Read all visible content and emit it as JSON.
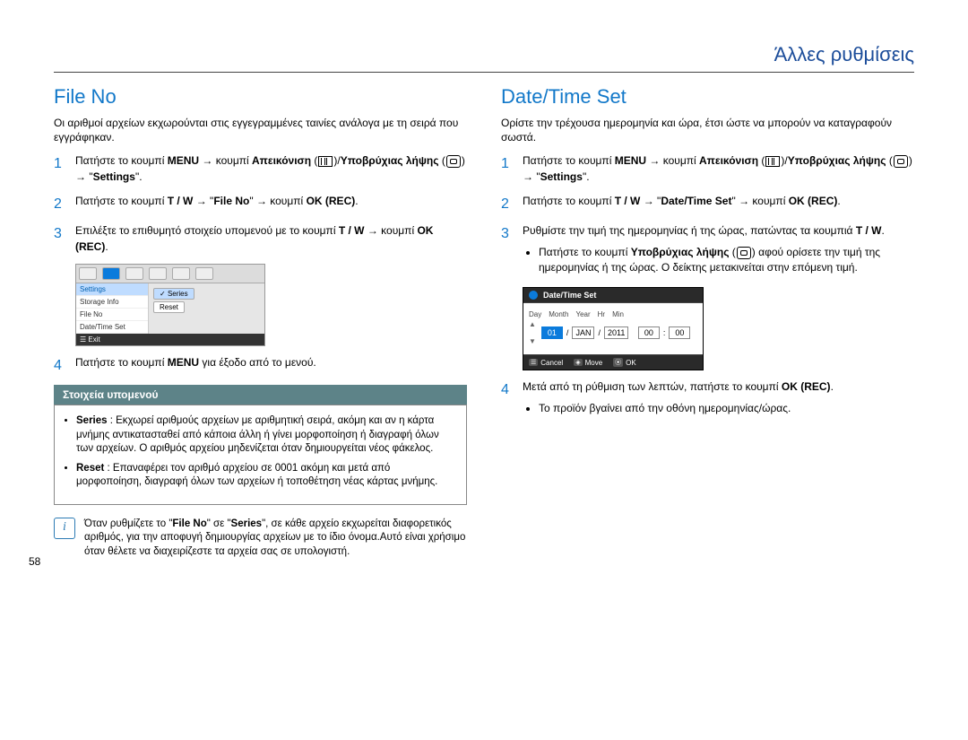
{
  "page_number": "58",
  "header": "Άλλες ρυθμίσεις",
  "left": {
    "title": "File No",
    "intro": "Οι αριθμοί αρχείων εκχωρούνται στις εγγεγραμμένες ταινίες ανάλογα με τη σειρά που εγγράφηκαν.",
    "s1_a": "Πατήστε το κουμπί ",
    "s1_b": "MENU",
    "s1_c": " → κουμπί ",
    "s1_d": "Απεικόνιση",
    "s1_e": " (",
    "s1_f": ")/",
    "s1_g": "Υποβρύχιας λήψης",
    "s1_h": " (",
    "s1_i": ") → \"",
    "s1_j": "Settings",
    "s1_k": "\".",
    "s2_a": "Πατήστε το κουμπί ",
    "s2_b": "T / W",
    "s2_c": " → \"",
    "s2_d": "File No",
    "s2_e": "\" → κουμπί ",
    "s2_f": "OK (REC)",
    "s2_g": ".",
    "s3_a": "Επιλέξτε το επιθυμητό στοιχείο υπομενού με το κουμπί ",
    "s3_b": "T / W",
    "s3_c": " → κουμπί ",
    "s3_d": "OK (REC)",
    "s3_e": ".",
    "s4_a": "Πατήστε το κουμπί ",
    "s4_b": "MENU",
    "s4_c": " για έξοδο από το μενού.",
    "mock": {
      "sidebar": {
        "settings": "Settings",
        "storage": "Storage Info",
        "fileno": "File No",
        "datetime": "Date/Time Set"
      },
      "opt_series": "Series",
      "opt_reset": "Reset",
      "footer": "Exit"
    },
    "sub_header": "Στοιχεία υπομενού",
    "sub_series_label": "Series",
    "sub_series_text": " : Εκχωρεί αριθμούς αρχείων με αριθμητική σειρά, ακόμη και αν η κάρτα μνήμης αντικατασταθεί από κάποια άλλη ή γίνει μορφοποίηση ή διαγραφή όλων των αρχείων. Ο αριθμός αρχείου μηδενίζεται όταν δημιουργείται νέος φάκελος.",
    "sub_reset_label": "Reset",
    "sub_reset_text": " : Επαναφέρει τον αριθμό αρχείου σε 0001 ακόμη και μετά από μορφοποίηση, διαγραφή όλων των αρχείων ή τοποθέτηση νέας κάρτας μνήμης.",
    "note_a": "Όταν ρυθμίζετε το \"",
    "note_b": "File No",
    "note_c": "\" σε \"",
    "note_d": "Series",
    "note_e": "\", σε κάθε αρχείο εκχωρείται διαφορετικός αριθμός, για την αποφυγή δημιουργίας αρχείων με το ίδιο όνομα.Αυτό είναι χρήσιμο όταν θέλετε να διαχειρίζεστε τα αρχεία σας σε υπολογιστή."
  },
  "right": {
    "title": "Date/Time Set",
    "intro": "Ορίστε την τρέχουσα ημερομηνία και ώρα, έτσι ώστε να μπορούν να καταγραφούν σωστά.",
    "s1_a": "Πατήστε το κουμπί ",
    "s1_b": "MENU",
    "s1_c": " → κουμπί ",
    "s1_d": "Απεικόνιση",
    "s1_e": " (",
    "s1_f": ")/",
    "s1_g": "Υποβρύχιας λήψης",
    "s1_h": " (",
    "s1_i": ") → \"",
    "s1_j": "Settings",
    "s1_k": "\".",
    "s2_a": "Πατήστε το κουμπί ",
    "s2_b": "T / W",
    "s2_c": " → \"",
    "s2_d": "Date/Time Set",
    "s2_e": "\" → κουμπί ",
    "s2_f": "OK (REC)",
    "s2_g": ".",
    "s3_a": "Ρυθμίστε την τιμή της ημερομηνίας ή της ώρας, πατώντας τα κουμπιά ",
    "s3_b": "T / W",
    "s3_c": ".",
    "s3_bullet_a": "Πατήστε το κουμπί ",
    "s3_bullet_b": "Υποβρύχιας λήψης",
    "s3_bullet_c": " (",
    "s3_bullet_d": ") αφού ορίσετε την τιμή της ημερομηνίας ή της ώρας. Ο δείκτης μετακινείται στην επόμενη τιμή.",
    "mock": {
      "title": "Date/Time Set",
      "labels": {
        "day": "Day",
        "month": "Month",
        "year": "Year",
        "hr": "Hr",
        "min": "Min"
      },
      "fields": {
        "day": "01",
        "month": "JAN",
        "year": "2011",
        "hr": "00",
        "min": "00"
      },
      "foot": {
        "cancel": "Cancel",
        "move": "Move",
        "ok": "OK"
      }
    },
    "s4_a": "Μετά από τη ρύθμιση των λεπτών, πατήστε το κουμπί ",
    "s4_b": "OK (REC)",
    "s4_c": ".",
    "s4_bullet": "Το προϊόν βγαίνει από την οθόνη ημερομηνίας/ώρας."
  }
}
